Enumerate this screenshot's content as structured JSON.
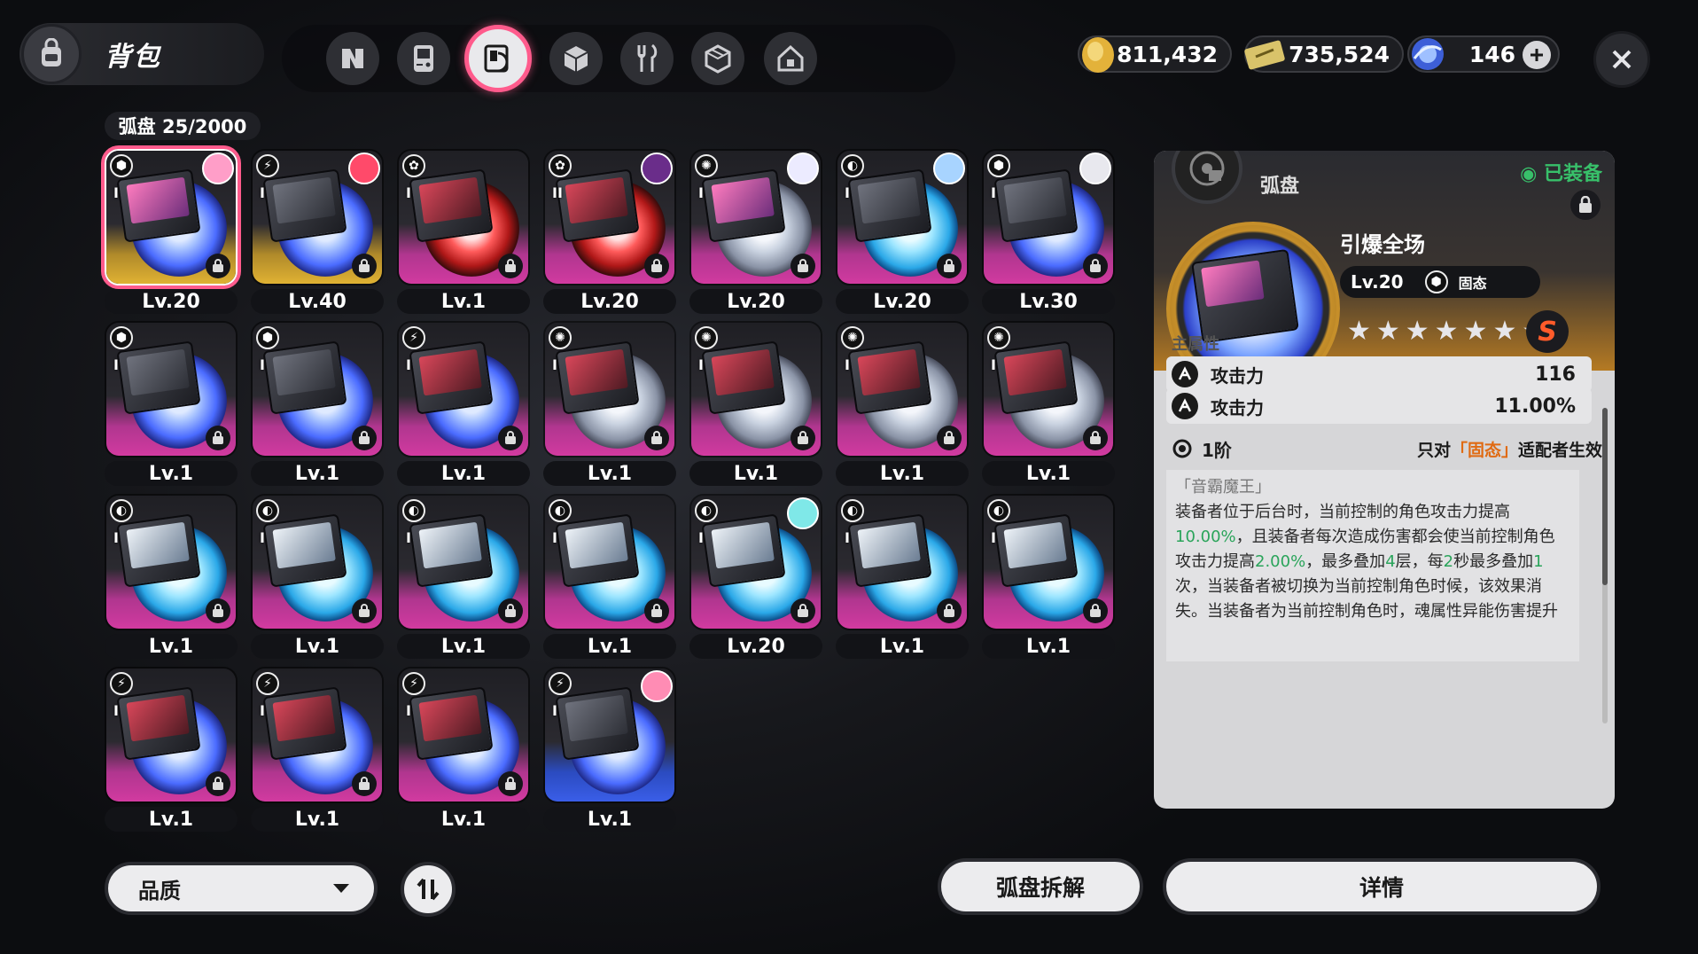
{
  "header": {
    "title": "背包"
  },
  "tabs": [
    {
      "icon": "n-logo-icon"
    },
    {
      "icon": "gameboy-icon"
    },
    {
      "icon": "disc-icon",
      "active": true
    },
    {
      "icon": "cube-icon"
    },
    {
      "icon": "fork-knife-icon"
    },
    {
      "icon": "package-icon"
    },
    {
      "icon": "home-icon"
    }
  ],
  "currency": [
    {
      "icon": "gold-coin-icon",
      "value": "811,432"
    },
    {
      "icon": "ticket-icon",
      "value": "735,524"
    },
    {
      "icon": "crystal-icon",
      "value": "146"
    }
  ],
  "inventory": {
    "count_label": "弧盘 25/2000",
    "items": [
      {
        "level": "Lv.20",
        "rank": "I",
        "attr": "⬢",
        "bg": "gold",
        "disc": "a",
        "case": "pink",
        "avatar": "#ff9ec8",
        "selected": true
      },
      {
        "level": "Lv.40",
        "rank": "I",
        "attr": "⚡",
        "bg": "gold",
        "disc": "a",
        "case": "",
        "avatar": "#ff4a6a"
      },
      {
        "level": "Lv.1",
        "rank": "I",
        "attr": "✿",
        "bg": "pink",
        "disc": "d",
        "case": "red"
      },
      {
        "level": "Lv.20",
        "rank": "II",
        "attr": "✿",
        "bg": "pink",
        "disc": "d",
        "case": "red",
        "avatar": "#6a2d8a"
      },
      {
        "level": "Lv.20",
        "rank": "I",
        "attr": "✺",
        "bg": "pink",
        "disc": "b",
        "case": "pink",
        "avatar": "#ecebff"
      },
      {
        "level": "Lv.20",
        "rank": "I",
        "attr": "◐",
        "bg": "pink",
        "disc": "c",
        "case": "",
        "avatar": "#a8d4ff"
      },
      {
        "level": "Lv.30",
        "rank": "I",
        "attr": "⬢",
        "bg": "pink",
        "disc": "a",
        "case": "",
        "avatar": "#e8e8ee"
      },
      {
        "level": "Lv.1",
        "rank": "I",
        "attr": "⬢",
        "bg": "pink",
        "disc": "a",
        "case": ""
      },
      {
        "level": "Lv.1",
        "rank": "I",
        "attr": "⬢",
        "bg": "pink",
        "disc": "a",
        "case": ""
      },
      {
        "level": "Lv.1",
        "rank": "I",
        "attr": "⚡",
        "bg": "pink",
        "disc": "a",
        "case": "red"
      },
      {
        "level": "Lv.1",
        "rank": "I",
        "attr": "✺",
        "bg": "pink",
        "disc": "b",
        "case": "red"
      },
      {
        "level": "Lv.1",
        "rank": "I",
        "attr": "✺",
        "bg": "pink",
        "disc": "b",
        "case": "red"
      },
      {
        "level": "Lv.1",
        "rank": "I",
        "attr": "✺",
        "bg": "pink",
        "disc": "b",
        "case": "red"
      },
      {
        "level": "Lv.1",
        "rank": "I",
        "attr": "✺",
        "bg": "pink",
        "disc": "b",
        "case": "red"
      },
      {
        "level": "Lv.1",
        "rank": "I",
        "attr": "◐",
        "bg": "pink",
        "disc": "c",
        "case": "ice"
      },
      {
        "level": "Lv.1",
        "rank": "I",
        "attr": "◐",
        "bg": "pink",
        "disc": "c",
        "case": "ice"
      },
      {
        "level": "Lv.1",
        "rank": "I",
        "attr": "◐",
        "bg": "pink",
        "disc": "c",
        "case": "ice"
      },
      {
        "level": "Lv.1",
        "rank": "I",
        "attr": "◐",
        "bg": "pink",
        "disc": "c",
        "case": "ice"
      },
      {
        "level": "Lv.20",
        "rank": "I",
        "attr": "◐",
        "bg": "pink",
        "disc": "c",
        "case": "ice",
        "avatar": "#7fe8e8"
      },
      {
        "level": "Lv.1",
        "rank": "I",
        "attr": "◐",
        "bg": "pink",
        "disc": "c",
        "case": "ice"
      },
      {
        "level": "Lv.1",
        "rank": "I",
        "attr": "◐",
        "bg": "pink",
        "disc": "c",
        "case": "ice"
      },
      {
        "level": "Lv.1",
        "rank": "I",
        "attr": "⚡",
        "bg": "pink",
        "disc": "a",
        "case": "red"
      },
      {
        "level": "Lv.1",
        "rank": "I",
        "attr": "⚡",
        "bg": "pink",
        "disc": "a",
        "case": "red"
      },
      {
        "level": "Lv.1",
        "rank": "I",
        "attr": "⚡",
        "bg": "pink",
        "disc": "a",
        "case": "red"
      },
      {
        "level": "Lv.1",
        "rank": "I",
        "attr": "⚡",
        "bg": "blue",
        "disc": "a",
        "case": "",
        "avatar": "#ff8cb4"
      }
    ]
  },
  "detail": {
    "category": "弧盘",
    "equipped_label": "◉ 已装备",
    "name": "引爆全场",
    "level": "Lv.20",
    "attribute_icon": "⬢",
    "attribute_name": "固态",
    "stars": "★★★★★★★",
    "grade": "S",
    "main_stats_label": "主属性",
    "stats": [
      {
        "name": "攻击力",
        "value": "116"
      },
      {
        "name": "攻击力",
        "value": "11.00%"
      }
    ],
    "tier_label": "1阶",
    "effect_prefix": "只对",
    "effect_highlight": "「固态」",
    "effect_suffix": "适配者生效",
    "desc_title": "「音霸魔王」",
    "desc_parts": [
      "装备者位于后台时，当前控制的角色攻击力提高",
      "10.00%",
      "，且装备者每次造成伤害都会使当前控制角色攻击力提高",
      "2.00%",
      "，最多叠加",
      "4",
      "层，每",
      "2",
      "秒最多叠加",
      "1",
      "次，当装备者被切换为当前控制角色时候，该效果消失。",
      "当装备者为当前控制角色时，魂属性异能伤害提升"
    ]
  },
  "bottom": {
    "filter_label": "品质",
    "dismantle_label": "弧盘拆解",
    "details_label": "详情"
  }
}
